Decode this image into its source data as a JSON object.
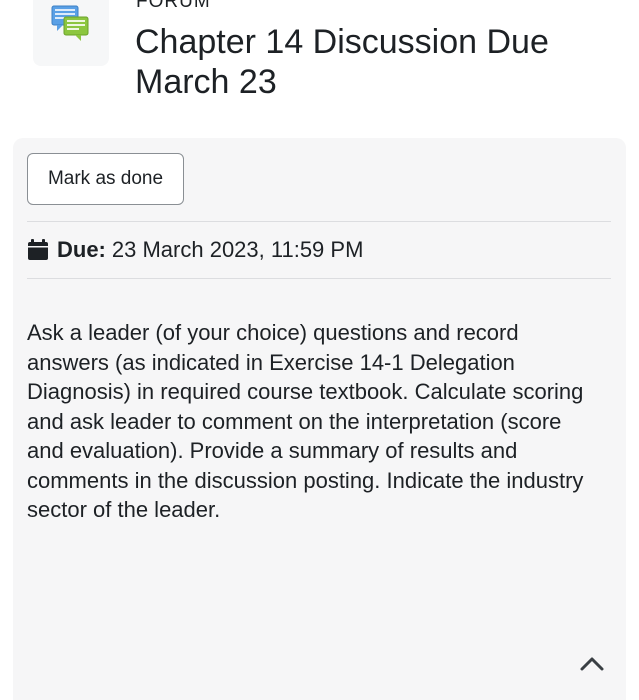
{
  "header": {
    "activity_type": "FORUM",
    "title": "Chapter 14 Discussion Due March 23",
    "icon": "forum-icon"
  },
  "completion": {
    "mark_done_label": "Mark as done"
  },
  "dates": {
    "due_label": "Due:",
    "due_value": "23 March 2023, 11:59 PM",
    "icon": "calendar-icon"
  },
  "description": {
    "text": "Ask a leader (of your choice) questions and record answers (as indicated in Exercise 14-1 Delegation Diagnosis) in required course textbook. Calculate scoring and ask leader to comment on the interpretation (score and evaluation). Provide a summary of results and comments in the discussion posting. Indicate the industry sector of the leader."
  },
  "footer": {
    "back_to_top_icon": "chevron-up-icon"
  },
  "colors": {
    "panel_bg": "#f6f6f7",
    "text": "#1d2125",
    "icon_blue": "#4a90d9",
    "icon_green": "#7cc242"
  }
}
